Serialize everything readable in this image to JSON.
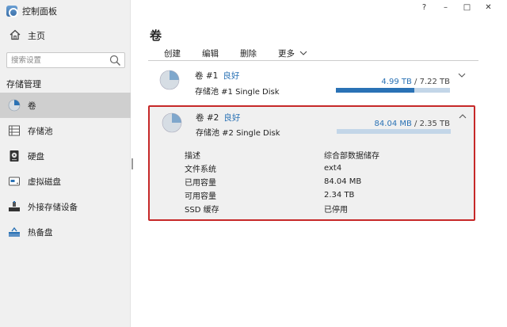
{
  "app": {
    "title": "控制面板"
  },
  "sidebar": {
    "home_label": "主页",
    "search_placeholder": "搜索设置",
    "section_title": "存储管理",
    "items": [
      {
        "label": "卷",
        "icon": "volume-pie-icon",
        "active": true
      },
      {
        "label": "存储池",
        "icon": "storage-pool-icon",
        "active": false
      },
      {
        "label": "硬盘",
        "icon": "hard-disk-icon",
        "active": false
      },
      {
        "label": "虚拟磁盘",
        "icon": "virtual-disk-icon",
        "active": false
      },
      {
        "label": "外接存储设备",
        "icon": "external-storage-icon",
        "active": false
      },
      {
        "label": "热备盘",
        "icon": "hot-spare-icon",
        "active": false
      }
    ]
  },
  "window_controls": {
    "help": "?",
    "minimize": "–",
    "maximize": "□",
    "close": "✕"
  },
  "main": {
    "title": "卷",
    "toolbar": {
      "create": "创建",
      "edit": "编辑",
      "delete": "删除",
      "more": "更多"
    },
    "volumes": [
      {
        "name": "卷 #1",
        "status": "良好",
        "pool": "存储池 #1   Single Disk",
        "used": "4.99 TB",
        "total": "/ 7.22 TB",
        "used_fraction": 0.69
      },
      {
        "name": "卷 #2",
        "status": "良好",
        "pool": "存储池 #2   Single Disk",
        "used": "84.04 MB",
        "total": "/ 2.35 TB",
        "used_fraction": 0.0,
        "details": [
          {
            "label": "描述",
            "value": "综合部数据储存"
          },
          {
            "label": "文件系统",
            "value": "ext4"
          },
          {
            "label": "已用容量",
            "value": "84.04 MB"
          },
          {
            "label": "可用容量",
            "value": "2.34 TB"
          },
          {
            "label": "SSD 缓存",
            "value": "已停用"
          }
        ]
      }
    ]
  },
  "colors": {
    "accent": "#2a72b5",
    "highlight_border": "#c62828",
    "sidebar_active": "#cfcfcf",
    "bar_bg": "#c3d6e8"
  }
}
